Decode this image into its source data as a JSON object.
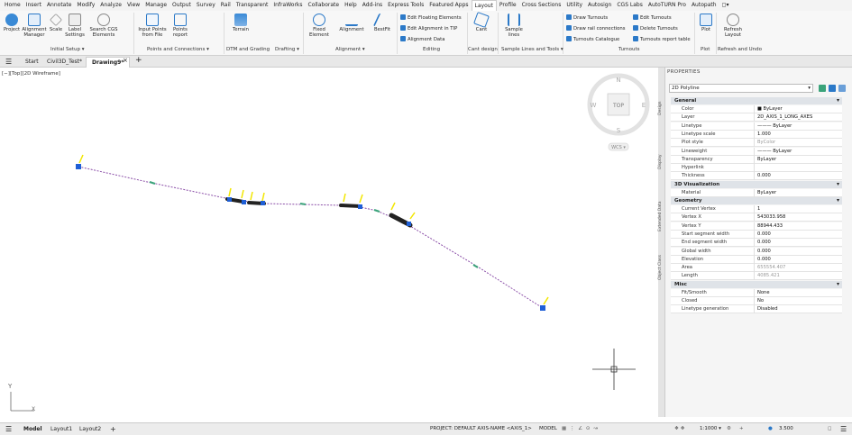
{
  "menu": [
    "Home",
    "Insert",
    "Annotate",
    "Modify",
    "Analyze",
    "View",
    "Manage",
    "Output",
    "Survey",
    "Rail",
    "Transparent",
    "InfraWorks",
    "Collaborate",
    "Help",
    "Add-ins",
    "Express Tools",
    "Featured Apps",
    "Layout",
    "Profile",
    "Cross Sections",
    "Utility",
    "Autosign",
    "CGS Labs",
    "AutoTURN Pro",
    "Autopath",
    "◻▾"
  ],
  "ribbon": {
    "project": "Project",
    "alignment_manager": "Alignment Manager",
    "scale": "Scale",
    "label_settings": "Label Settings",
    "search_cgs": "Search CGS Elements",
    "input_points": "Input Points from File",
    "points_report": "Points report",
    "terrain": "Terrain",
    "fixed_element": "Fixed Element",
    "alignment": "Alignment",
    "bestfit": "BestFit",
    "edit_floating": "Edit Floating Elements",
    "edit_alignment_tip": "Edit Alignment in TIP",
    "alignment_data": "Alignment Data",
    "cant": "Cant",
    "sample_lines": "Sample lines",
    "draw_turnouts": "Draw Turnouts",
    "draw_rail": "Draw rail connections",
    "turnouts_catalogue": "Turnouts Catalogue",
    "edit_turnouts": "Edit Turnouts",
    "delete_turnouts": "Delete Turnouts",
    "turnouts_report": "Turnouts report table",
    "plot": "Plot",
    "refresh_layout": "Refresh Layout",
    "groups": [
      "Initial Setup ▾",
      "Points and Connections ▾",
      "DTM and Grading",
      "Drafting ▾",
      "Alignment ▾",
      "Editing",
      "Cant design",
      "Sample Lines and Tools ▾",
      "Turnouts",
      "Plot",
      "Refresh and Undo"
    ]
  },
  "file_tabs": [
    "Start",
    "Civil3D_Test*",
    "Drawing9*"
  ],
  "view_label": "[−][Top][2D Wireframe]",
  "viewcube": {
    "top": "TOP",
    "n": "N",
    "s": "S",
    "w": "W",
    "e": "E",
    "wcs": "WCS ▾"
  },
  "ucs": {
    "x": "X",
    "y": "Y"
  },
  "properties": {
    "title": "PROPERTIES",
    "selection": "2D Polyline",
    "side_tabs": [
      "Design",
      "Display",
      "Extended Data",
      "Object Class"
    ],
    "general_title": "General",
    "general": [
      {
        "k": "Color",
        "v": "■ ByLayer"
      },
      {
        "k": "Layer",
        "v": "2D_AXIS_1_LONG_AXES"
      },
      {
        "k": "Linetype",
        "v": "——— ByLayer"
      },
      {
        "k": "Linetype scale",
        "v": "1.000"
      },
      {
        "k": "Plot style",
        "v": "ByColor"
      },
      {
        "k": "Lineweight",
        "v": "——— ByLayer"
      },
      {
        "k": "Transparency",
        "v": "ByLayer"
      },
      {
        "k": "Hyperlink",
        "v": ""
      },
      {
        "k": "Thickness",
        "v": "0.000"
      }
    ],
    "viz_title": "3D Visualization",
    "viz": [
      {
        "k": "Material",
        "v": "ByLayer"
      }
    ],
    "geo_title": "Geometry",
    "geo": [
      {
        "k": "Current Vertex",
        "v": "1"
      },
      {
        "k": "Vertex X",
        "v": "543033.958"
      },
      {
        "k": "Vertex Y",
        "v": "88944.433"
      },
      {
        "k": "Start segment width",
        "v": "0.000"
      },
      {
        "k": "End segment width",
        "v": "0.000"
      },
      {
        "k": "Global width",
        "v": "0.000"
      },
      {
        "k": "Elevation",
        "v": "0.000"
      },
      {
        "k": "Area",
        "v": "655554.407"
      },
      {
        "k": "Length",
        "v": "4085.421"
      }
    ],
    "misc_title": "Misc",
    "misc": [
      {
        "k": "Fit/Smooth",
        "v": "None"
      },
      {
        "k": "Closed",
        "v": "No"
      },
      {
        "k": "Linetype generation",
        "v": "Disabled"
      }
    ]
  },
  "status": {
    "layout_tabs": [
      "Model",
      "Layout1",
      "Layout2"
    ],
    "project": "PROJECT: DEFAULT   AXIS-NAME <AXIS_1>",
    "model": "MODEL",
    "scale": "1:1000 ▾",
    "zoom": "3.500"
  }
}
